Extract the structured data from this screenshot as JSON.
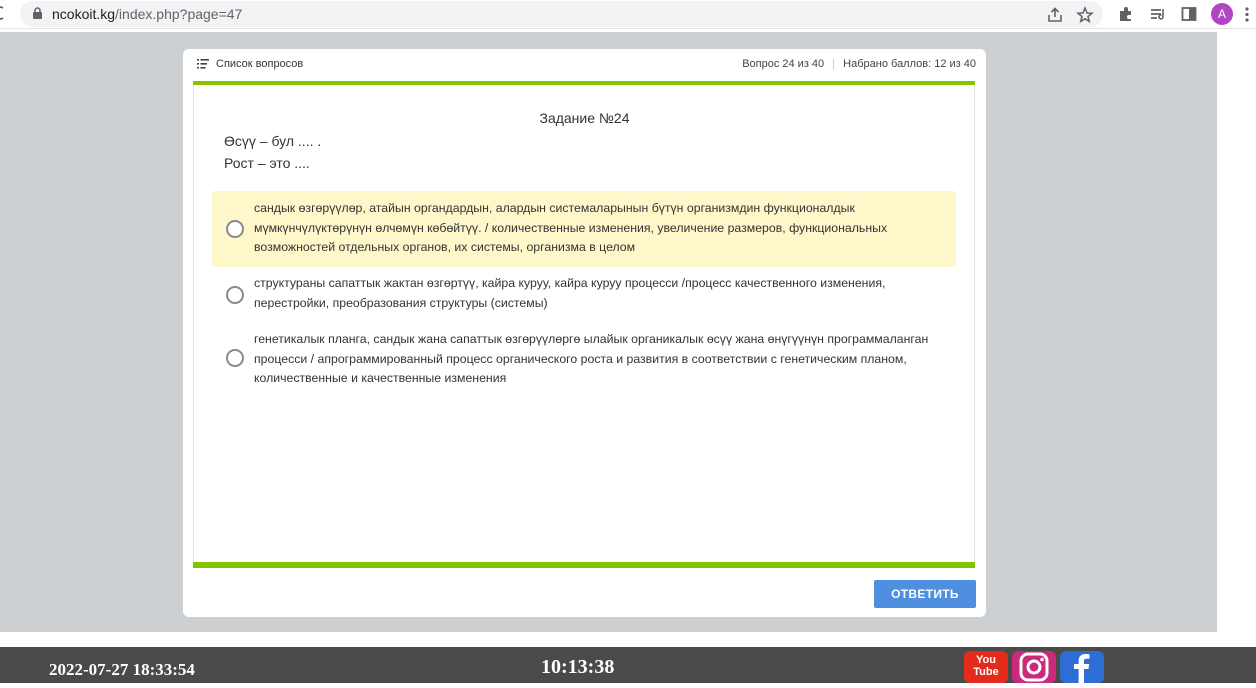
{
  "browser": {
    "url_host": "ncokoit.kg",
    "url_path": "/index.php?page=47",
    "avatar_letter": "A",
    "icons": [
      "reload-icon",
      "lock-icon",
      "share-icon",
      "star-icon",
      "extensions-icon",
      "reading-list-icon",
      "side-panel-icon",
      "profile-avatar",
      "menu-icon"
    ]
  },
  "quiz": {
    "question_list_label": "Список вопросов",
    "progress": "Вопрос 24 из 40",
    "score": "Набрано баллов: 12 из 40",
    "task_title": "Задание №24",
    "question_ky": "Өсүү – бул .... .",
    "question_ru": "Рост – это ....",
    "answers": [
      {
        "text": "сандык өзгөрүүлөр, атайын органдардын, алардын системаларынын бүтүн организмдин функционалдык мүмкүнчүлүктөрүнүн өлчөмүн көбөйтүү.  / количественные изменения, увеличение размеров, функциональных возможностей отдельных органов, их системы, организма в целом",
        "highlighted": true
      },
      {
        "text": "структураны сапаттык жактан өзгөртүү, кайра куруу, кайра куруу процесси   /процесс качественного изменения, перестройки, преобразования структуры (системы)",
        "highlighted": false
      },
      {
        "text": "генетикалык планга, сандык жана сапаттык өзгөрүүлөргө ылайык органикалык өсүү жана өнүгүүнүн программаланган процесси / апрограммированный процесс органического роста и развития в соответствии с генетическим планом, количественные и качественные изменения",
        "highlighted": false
      }
    ],
    "submit_label": "ОТВЕТИТЬ"
  },
  "taskbar": {
    "datetime": "2022-07-27 18:33:54",
    "clock": "10:13:38",
    "youtube_label_top": "You",
    "youtube_label_bottom": "Tube",
    "social_icons": [
      "youtube-icon",
      "instagram-icon",
      "facebook-icon"
    ]
  },
  "colors": {
    "accent_green": "#86c400",
    "button_blue": "#4f8fe0",
    "highlight_yellow": "#fdf7c9",
    "backdrop_gray": "#cdd0d3",
    "taskbar_gray": "#4a4a4a"
  }
}
